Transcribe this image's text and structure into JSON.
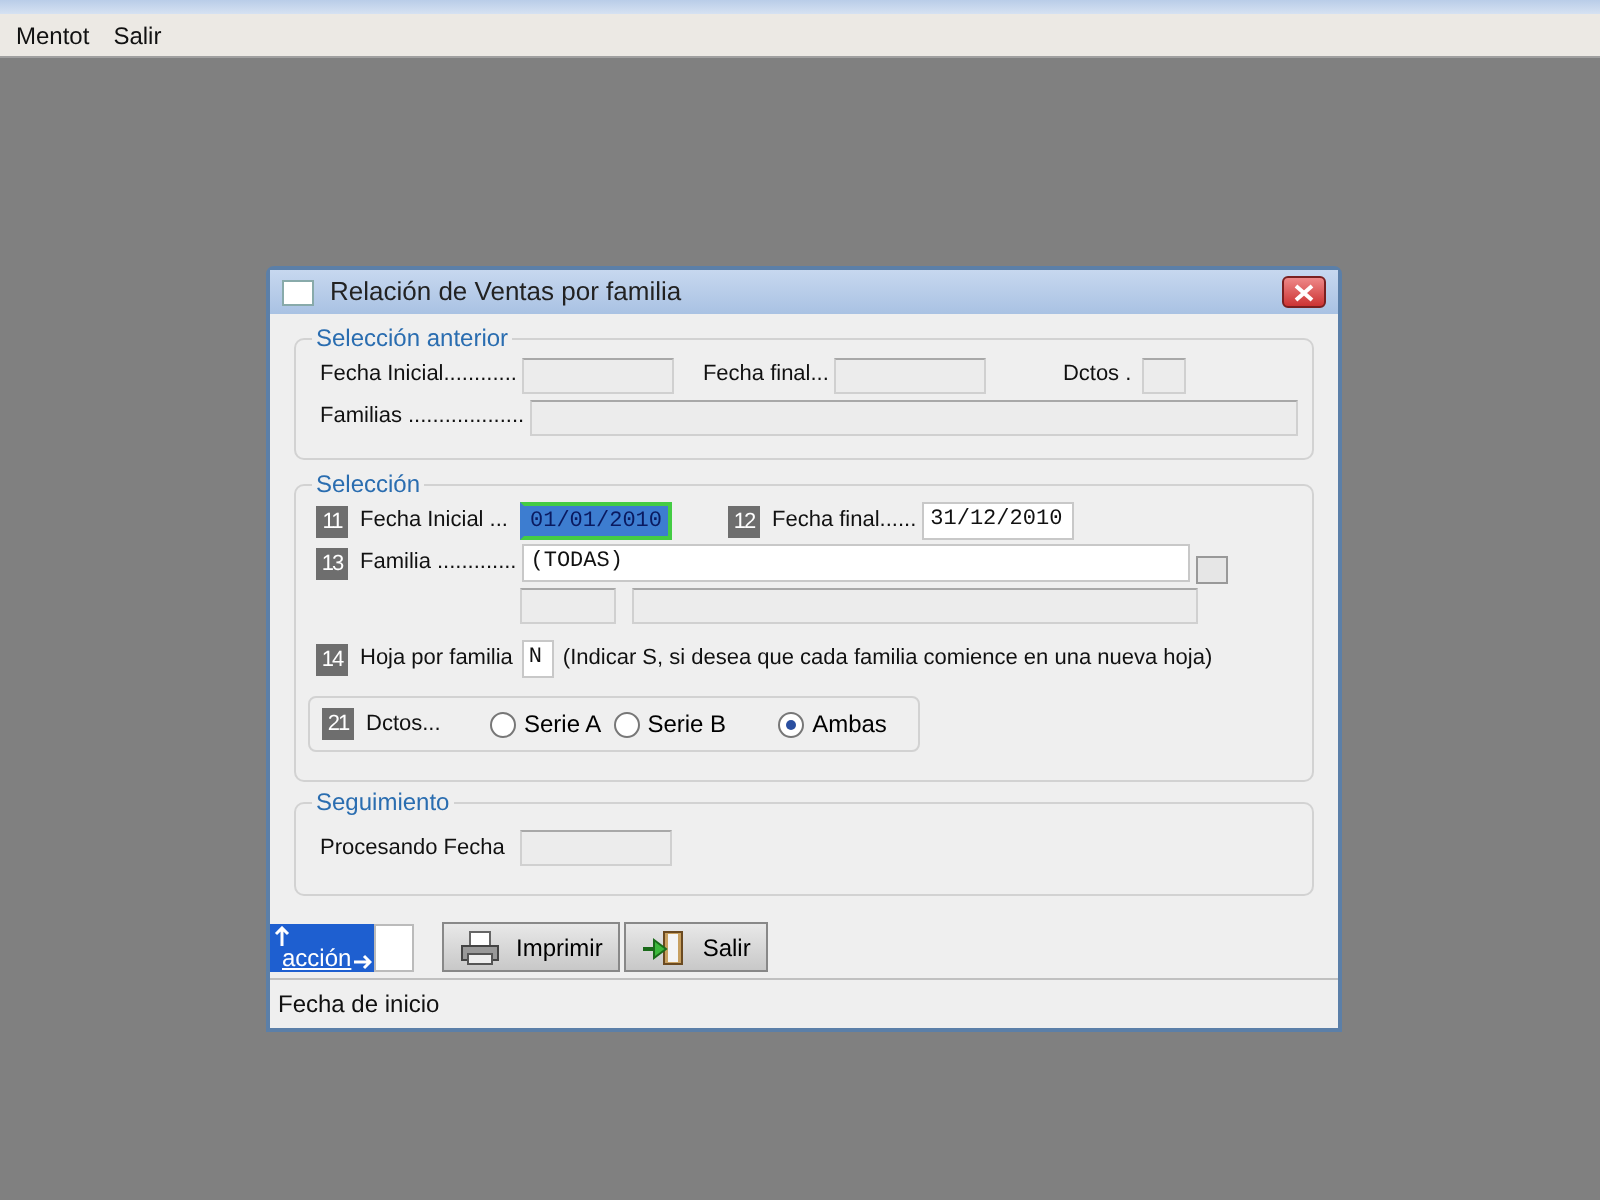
{
  "menu": [
    {
      "label": "Mentot"
    },
    {
      "label": "Salir"
    }
  ],
  "dialog": {
    "title": "Relación de Ventas por familia",
    "previous_selection": {
      "legend": "Selección anterior",
      "start_label": "Fecha Inicial............",
      "end_label": "Fecha final...",
      "docs_label": "Dctos .",
      "families_label": "Familias ..................."
    },
    "selection": {
      "legend": "Selección",
      "start_date": {
        "number": "11",
        "label": "Fecha Inicial ...",
        "value": "01/01/2010",
        "selected": true
      },
      "end_date": {
        "number": "12",
        "label": "Fecha final......",
        "value": "31/12/2010",
        "selected": false
      },
      "family": {
        "number": "13",
        "label": "Familia .............",
        "value": "(TODAS)"
      },
      "page_per_family": {
        "number": "14",
        "label": "Hoja por familia",
        "value": "N",
        "hint": "(Indicar S, si desea que cada familia comience en una nueva hoja)"
      },
      "documents": {
        "number": "21",
        "label": "Dctos...",
        "options": [
          {
            "label": "Serie A",
            "selected": false
          },
          {
            "label": "Serie B",
            "selected": false
          },
          {
            "label": "Ambas",
            "selected": true
          }
        ]
      }
    },
    "tracking": {
      "legend": "Seguimiento",
      "label": "Procesando Fecha"
    },
    "action_label": "acción",
    "buttons": [
      {
        "kind": "print",
        "label": "Imprimir"
      },
      {
        "kind": "exit",
        "label": "Salir"
      }
    ],
    "status": "Fecha de inicio"
  }
}
